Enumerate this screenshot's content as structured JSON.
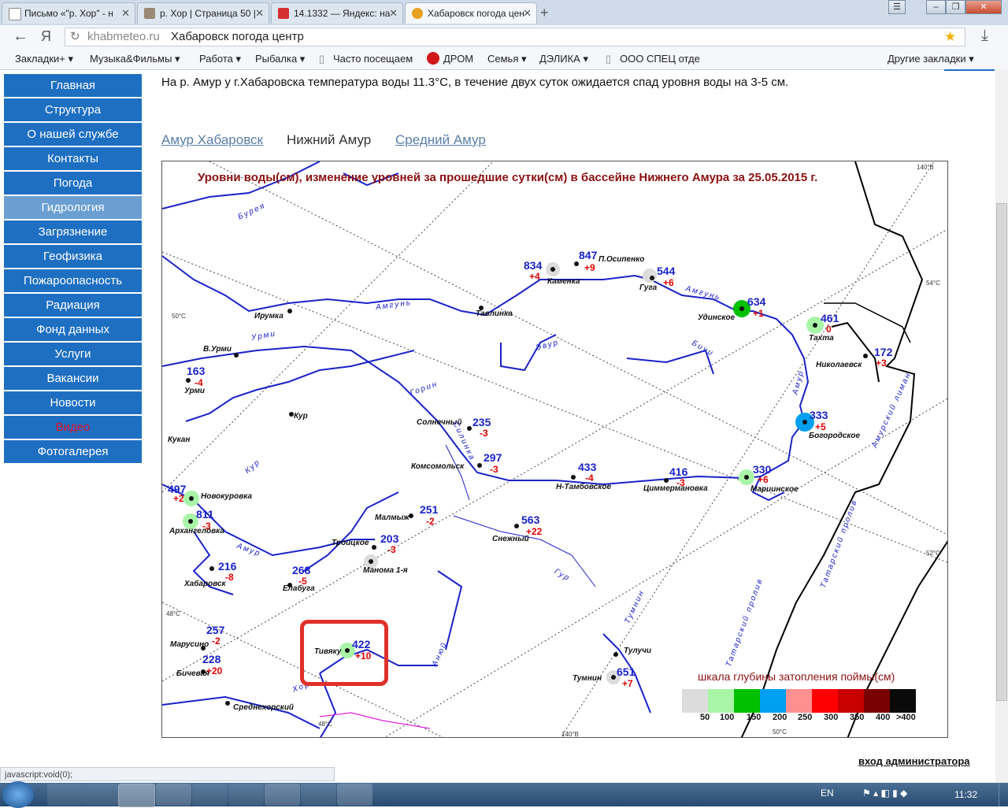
{
  "browser": {
    "tabs": [
      {
        "label": "Письмо «\"р. Хор\" - н",
        "color": "#8a8a8a"
      },
      {
        "label": "р. Хор | Страница 50 |",
        "color": "#7a6a5a"
      },
      {
        "label": "14.1332 — Яндекс: на",
        "color": "#d43030"
      },
      {
        "label": "Хабаровск погода цен",
        "color": "#e7a020"
      }
    ],
    "address_domain": "khabmeteo.ru",
    "address_title": "Хабаровск погода центр",
    "yandex_glyph": "Я",
    "bookmarks": [
      "Закладки+ ▾",
      "Музыка&Фильмы ▾",
      "Работа ▾",
      "Рыбалка ▾",
      "Часто посещаем",
      "ДРОМ",
      "Семья ▾",
      "ДЭЛИКА ▾",
      "ООО СПЕЦ отде",
      "Другие закладки ▾"
    ]
  },
  "sidebar": {
    "items": [
      "Главная",
      "Структура",
      "О нашей службе",
      "Контакты",
      "Погода",
      "Гидрология",
      "Загрязнение",
      "Геофизика",
      "Пожароопасность",
      "Радиация",
      "Фонд данных",
      "Услуги",
      "Вакансии",
      "Новости",
      "Видео",
      "Фотогалерея"
    ],
    "selected_index": 5,
    "highlight_index": 14
  },
  "content": {
    "intro": "На р. Амур у г.Хабаровска температура воды 11.3°С, в течение двух суток ожидается спад уровня воды на 3-5 см.",
    "tabs": [
      "Амур Хабаровск",
      "Нижний Амур",
      "Средний Амур"
    ],
    "admin_link": "вход администратора"
  },
  "map": {
    "title": "Уровни воды(см), изменение уровней за прошедшие сутки(см) в бассейне Нижнего Амура за 25.05.2015 г.",
    "stations": [
      {
        "name": "Каменка",
        "level": "834",
        "change": "+4"
      },
      {
        "name": "П.Осипенко",
        "level": "847",
        "change": "+9"
      },
      {
        "name": "Гуга",
        "level": "544",
        "change": "+6"
      },
      {
        "name": "Удинское",
        "level": "634",
        "change": "+1"
      },
      {
        "name": "Тахта",
        "level": "461",
        "change": "0"
      },
      {
        "name": "Николаевск",
        "level": "172",
        "change": "+3"
      },
      {
        "name": "Урми",
        "level": "163",
        "change": "-4"
      },
      {
        "name": "Солнечный",
        "level": "235",
        "change": "-3"
      },
      {
        "name": "Богородское",
        "level": "333",
        "change": "+5"
      },
      {
        "name": "Комсомольск",
        "level": "297",
        "change": "-3"
      },
      {
        "name": "Н-Тамбовское",
        "level": "433",
        "change": "-4"
      },
      {
        "name": "Циммермановка",
        "level": "416",
        "change": "-3"
      },
      {
        "name": "Мариинское",
        "level": "330",
        "change": "+6"
      },
      {
        "name": "Новокуровка",
        "level": "497",
        "change": "+2"
      },
      {
        "name": "Архангеловка",
        "level": "811",
        "change": "-3"
      },
      {
        "name": "Малмыж",
        "level": "251",
        "change": "-2"
      },
      {
        "name": "Снежный",
        "level": "563",
        "change": "+22"
      },
      {
        "name": "Троицкое",
        "level": "203",
        "change": "-3"
      },
      {
        "name": "Хабаровск",
        "level": "216",
        "change": "-8"
      },
      {
        "name": "Елабуга",
        "level": "268",
        "change": "-5"
      },
      {
        "name": "Марусино",
        "level": "257",
        "change": "-2"
      },
      {
        "name": "Тивяку",
        "level": "422",
        "change": "+10"
      },
      {
        "name": "Бичевая",
        "level": "228",
        "change": "+20"
      },
      {
        "name": "Тумнин",
        "level": "651",
        "change": "+7"
      }
    ],
    "places": [
      "Ирумка",
      "Тавлинка",
      "В.Урми",
      "Кур",
      "Кукан",
      "Манома 1-я",
      "Тулучи",
      "Среднехорский"
    ],
    "rivers": [
      "Бурея",
      "Амгунь",
      "Амгунь",
      "Урми",
      "Эвур",
      "Бичи",
      "Горин",
      "Силинка",
      "Кур",
      "Амур",
      "Амур",
      "Гур",
      "Анюй",
      "Хор",
      "Тумнин",
      "Амурский лиман",
      "Татарский пролив",
      "Татарский пролив"
    ],
    "coords": [
      "140°В",
      "54°С",
      "50°С",
      "52°С",
      "48°С",
      "48°С",
      "140°В",
      "50°С"
    ],
    "scale": {
      "title": "шкала  глубины затопления поймы(см)",
      "colors": [
        "#dcdcdc",
        "#a8f5a8",
        "#00c000",
        "#00a0f0",
        "#ff9090",
        "#ff0000",
        "#c80000",
        "#780000",
        "#0a0a0a"
      ],
      "labels": [
        "50",
        "100",
        "150",
        "200",
        "250",
        "300",
        "350",
        "400",
        ">400"
      ]
    }
  },
  "status_text": "javascript:void(0);",
  "taskbar": {
    "lang": "EN",
    "time": "11:32"
  }
}
